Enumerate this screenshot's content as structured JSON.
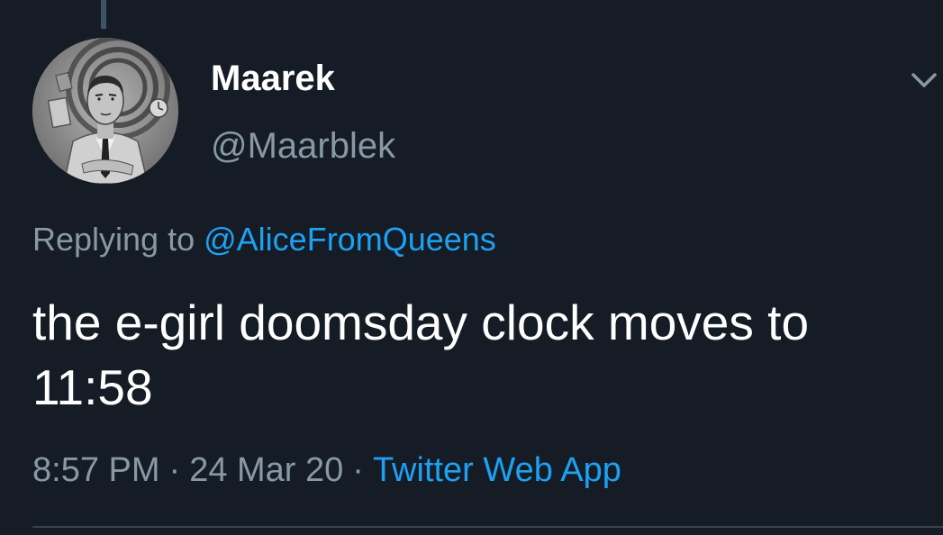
{
  "tweet": {
    "author": {
      "display_name": "Maarek",
      "handle": "@Maarblek"
    },
    "reply": {
      "prefix": "Replying to",
      "mention": "@AliceFromQueens"
    },
    "text": "the e-girl doomsday clock moves to 11:58",
    "meta": {
      "time": "8:57 PM",
      "separator": "·",
      "date": "24 Mar 20",
      "source": "Twitter Web App"
    }
  },
  "icons": {
    "more": "chevron-down-icon"
  },
  "colors": {
    "background": "#151c25",
    "primary_text": "#ffffff",
    "secondary_text": "#8899a6",
    "link": "#1da1f2",
    "divider": "#38444d"
  }
}
